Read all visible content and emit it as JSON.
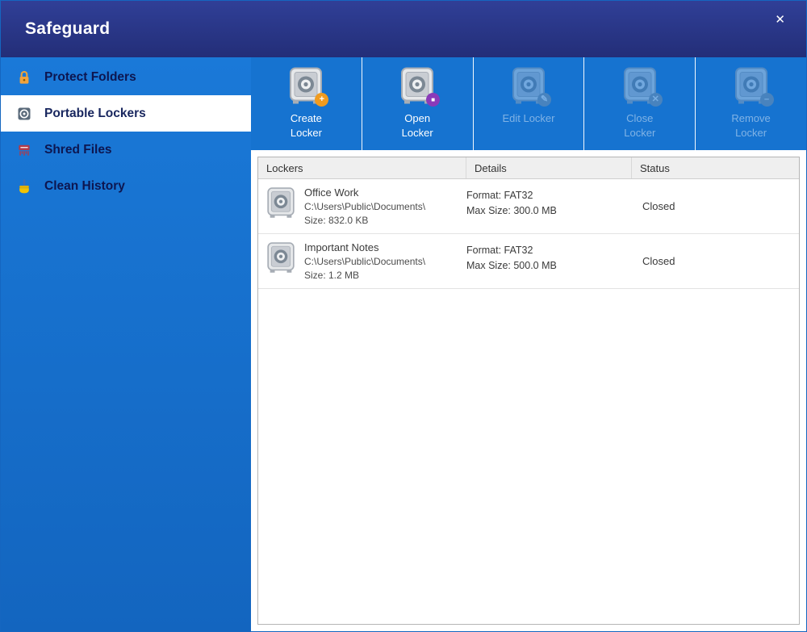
{
  "window": {
    "title": "Safeguard",
    "close_glyph": "✕"
  },
  "colors": {
    "titlebar": "#2a3784",
    "sidebar_blue": "#1673d0",
    "selected_text": "#18265e",
    "accent_orange": "#f09b1f",
    "accent_purple": "#8a3ab9"
  },
  "sidebar": {
    "items": [
      {
        "label": "Protect Folders",
        "icon": "lock-icon",
        "selected": false
      },
      {
        "label": "Portable Lockers",
        "icon": "locker-icon",
        "selected": true
      },
      {
        "label": "Shred Files",
        "icon": "shredder-icon",
        "selected": false
      },
      {
        "label": "Clean History",
        "icon": "brush-icon",
        "selected": false
      }
    ]
  },
  "toolbar": {
    "buttons": [
      {
        "label": "Create Locker",
        "enabled": true,
        "badge_glyph": "+",
        "badge_css": "background:#f09b1f"
      },
      {
        "label": "Open Locker",
        "enabled": true,
        "badge_glyph": "■",
        "badge_css": "background:#8a3ab9; font-size:8px"
      },
      {
        "label": "Edit Locker",
        "enabled": false,
        "badge_glyph": "✎",
        "badge_css": "background:#8d99a6"
      },
      {
        "label": "Close Locker",
        "enabled": false,
        "badge_glyph": "✕",
        "badge_css": "background:#8d99a6"
      },
      {
        "label": "Remove Locker",
        "enabled": false,
        "badge_glyph": "–",
        "badge_css": "background:#8d99a6"
      }
    ]
  },
  "table": {
    "columns": [
      "Lockers",
      "Details",
      "Status"
    ],
    "rows": [
      {
        "name": "Office Work",
        "path": "C:\\Users\\Public\\Documents\\",
        "size": "Size: 832.0 KB",
        "format": "Format: FAT32",
        "max_size": "Max Size: 300.0 MB",
        "status": "Closed"
      },
      {
        "name": "Important Notes",
        "path": "C:\\Users\\Public\\Documents\\",
        "size": "Size: 1.2 MB",
        "format": "Format: FAT32",
        "max_size": "Max Size: 500.0 MB",
        "status": "Closed"
      }
    ]
  }
}
